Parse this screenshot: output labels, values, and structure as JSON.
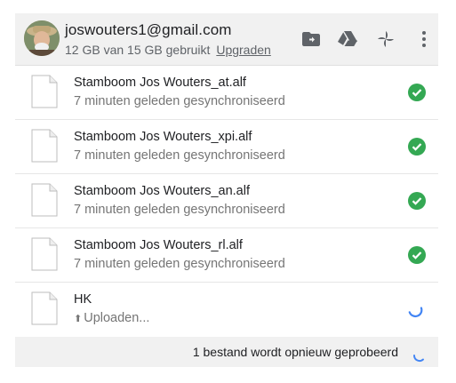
{
  "header": {
    "email": "joswouters1@gmail.com",
    "quota_text": "12 GB van 15 GB gebruikt",
    "upgrade_label": "Upgraden"
  },
  "files": [
    {
      "name": "Stamboom Jos Wouters_at.alf",
      "status": "7 minuten geleden gesynchroniseerd",
      "state": "synced"
    },
    {
      "name": "Stamboom Jos Wouters_xpi.alf",
      "status": "7 minuten geleden gesynchroniseerd",
      "state": "synced"
    },
    {
      "name": "Stamboom Jos Wouters_an.alf",
      "status": "7 minuten geleden gesynchroniseerd",
      "state": "synced"
    },
    {
      "name": "Stamboom Jos Wouters_rl.alf",
      "status": "7 minuten geleden gesynchroniseerd",
      "state": "synced"
    },
    {
      "name": "HK",
      "status": "Uploaden...",
      "state": "uploading"
    }
  ],
  "footer": {
    "retry_text": "1 bestand wordt opnieuw geprobeerd"
  },
  "colors": {
    "check_green": "#34a853",
    "spinner_blue": "#4285f4",
    "header_bg": "#f1f1f1"
  },
  "icons": [
    "folder-icon",
    "drive-icon",
    "photos-icon",
    "more-vert-icon",
    "file-icon",
    "check-circle-icon",
    "spinner-icon",
    "upload-arrow-icon"
  ]
}
